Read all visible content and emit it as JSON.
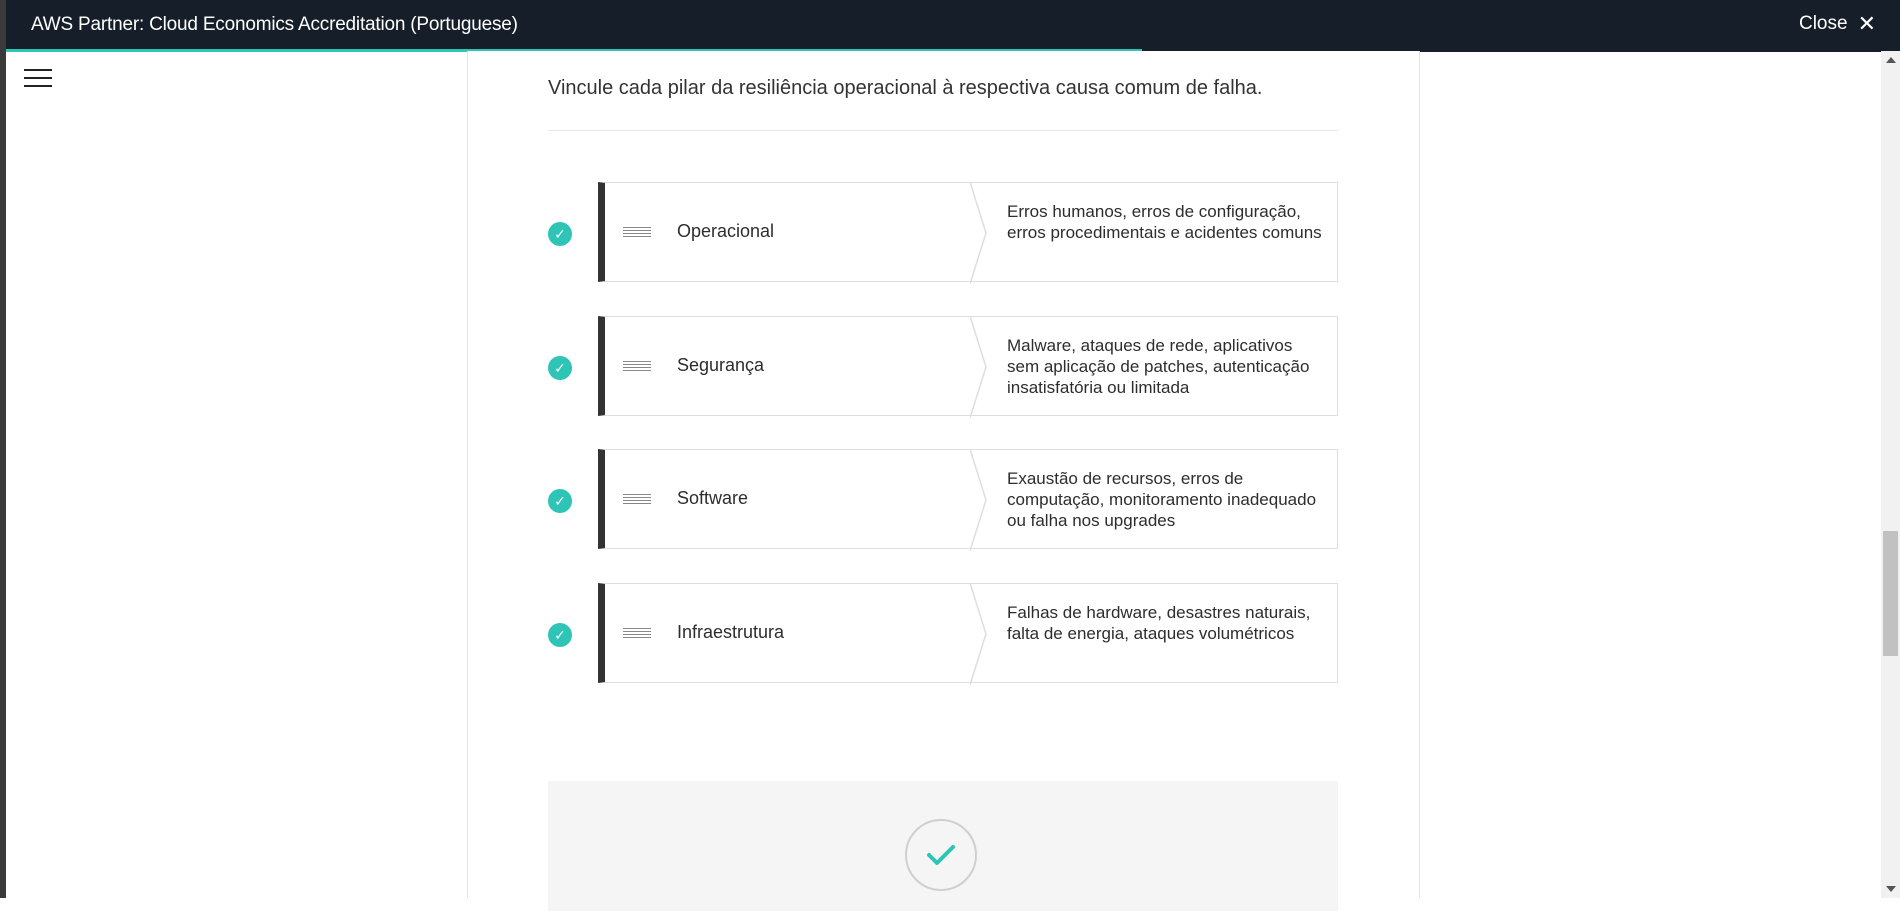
{
  "header": {
    "title": "AWS Partner: Cloud Economics Accreditation (Portuguese)",
    "close_label": "Close",
    "progress_fraction": 0.6
  },
  "content": {
    "instruction": "Vincule cada pilar da resiliência operacional à respectiva causa comum de falha.",
    "pairs": [
      {
        "term": "Operacional",
        "description": "Erros humanos, erros de configuração, erros procedimentais e acidentes comuns"
      },
      {
        "term": "Segurança",
        "description": "Malware, ataques de rede, aplicativos sem aplicação de patches, autenticação insatisfatória ou limitada"
      },
      {
        "term": "Software",
        "description": "Exaustão de recursos, erros de computação, monitoramento inadequado ou falha nos upgrades"
      },
      {
        "term": "Infraestrutura",
        "description": "Falhas de hardware, desastres naturais, falta de energia, ataques volumétricos"
      }
    ]
  },
  "colors": {
    "header_bg": "#161e29",
    "accent": "#2ec4b6",
    "pair_bar": "#333333"
  },
  "icons": [
    "menu-icon",
    "close-icon",
    "check-icon",
    "drag-handle-icon",
    "checkmark-icon"
  ]
}
